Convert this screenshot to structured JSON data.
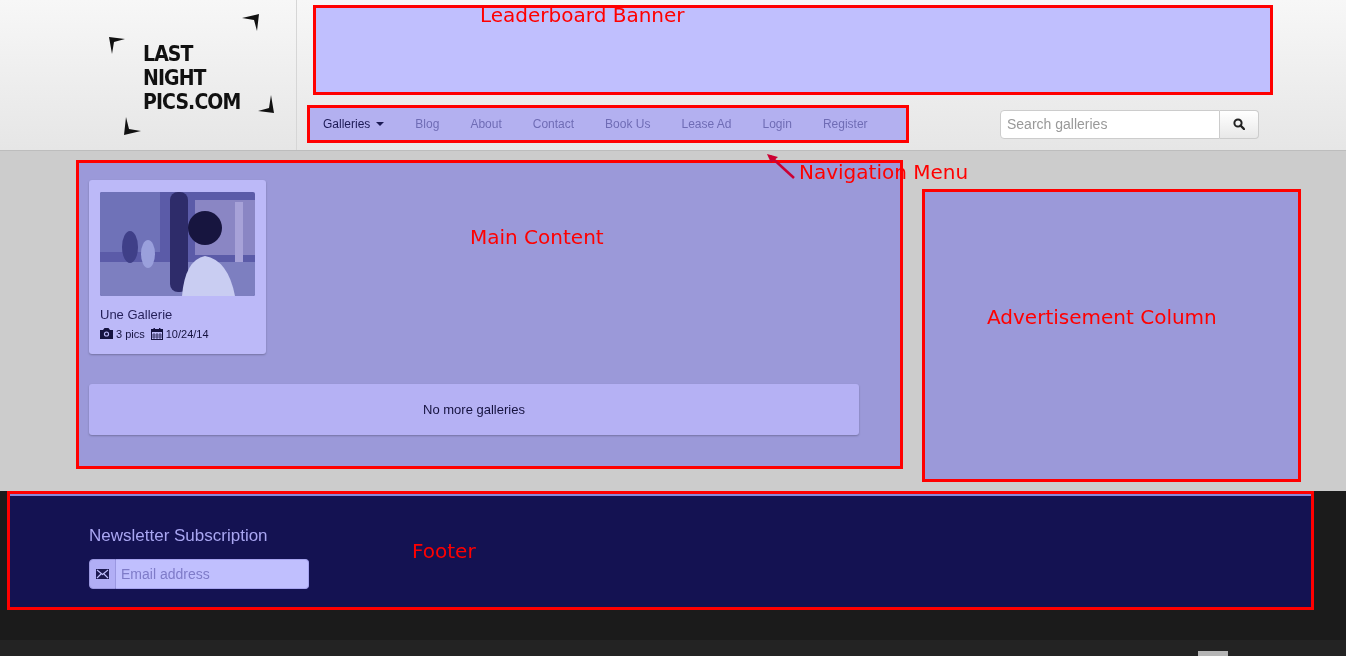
{
  "logo": {
    "lines": [
      "LAST",
      "NIGHT",
      "PICS.COM"
    ]
  },
  "nav": {
    "items": [
      {
        "label": "Galleries",
        "selected": true,
        "dropdown": true
      },
      {
        "label": "Blog",
        "selected": false,
        "dropdown": false
      },
      {
        "label": "About",
        "selected": false,
        "dropdown": false
      },
      {
        "label": "Contact",
        "selected": false,
        "dropdown": false
      },
      {
        "label": "Book Us",
        "selected": false,
        "dropdown": false
      },
      {
        "label": "Lease Ad",
        "selected": false,
        "dropdown": false
      },
      {
        "label": "Login",
        "selected": false,
        "dropdown": false
      },
      {
        "label": "Register",
        "selected": false,
        "dropdown": false
      }
    ]
  },
  "search": {
    "placeholder": "Search galleries"
  },
  "galleries": [
    {
      "title": "Une Gallerie",
      "pics": "3 pics",
      "date": "10/24/14"
    }
  ],
  "end_message": "No more galleries",
  "footer": {
    "heading": "Newsletter Subscription",
    "email": {
      "placeholder": "Email address"
    }
  },
  "annotations": [
    {
      "label": "Leaderboard Banner",
      "kind": "banner"
    },
    {
      "label": "Navigation Menu",
      "kind": "nav"
    },
    {
      "label": "Main Content",
      "kind": "main"
    },
    {
      "label": "Advertisement Column",
      "kind": "ads"
    },
    {
      "label": "Footer",
      "kind": "footer"
    }
  ]
}
